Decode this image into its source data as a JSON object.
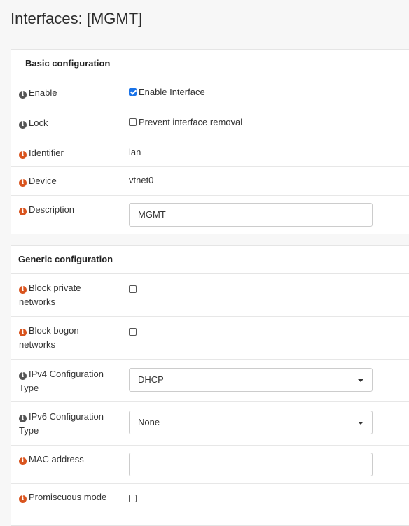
{
  "page": {
    "title": "Interfaces: [MGMT]"
  },
  "basic": {
    "heading": "Basic configuration",
    "enable": {
      "label": "Enable",
      "checkbox_label": "Enable Interface",
      "checked": true
    },
    "lock": {
      "label": "Lock",
      "checkbox_label": "Prevent interface removal",
      "checked": false
    },
    "identifier": {
      "label": "Identifier",
      "value": "lan"
    },
    "device": {
      "label": "Device",
      "value": "vtnet0"
    },
    "description": {
      "label": "Description",
      "value": "MGMT"
    }
  },
  "generic": {
    "heading": "Generic configuration",
    "block_private": {
      "label": "Block private networks",
      "checked": false
    },
    "block_bogon": {
      "label": "Block bogon networks",
      "checked": false
    },
    "ipv4_type": {
      "label": "IPv4 Configuration Type",
      "value": "DHCP"
    },
    "ipv6_type": {
      "label": "IPv6 Configuration Type",
      "value": "None"
    },
    "mac": {
      "label": "MAC address",
      "value": ""
    },
    "promisc": {
      "label": "Promiscuous mode",
      "checked": false
    }
  },
  "icons": {
    "info_help": "info-circle-icon",
    "info_required": "info-circle-icon"
  },
  "colors": {
    "info_gray": "#555555",
    "info_orange": "#d9541e",
    "checkbox_checked": "#1a73e8"
  }
}
